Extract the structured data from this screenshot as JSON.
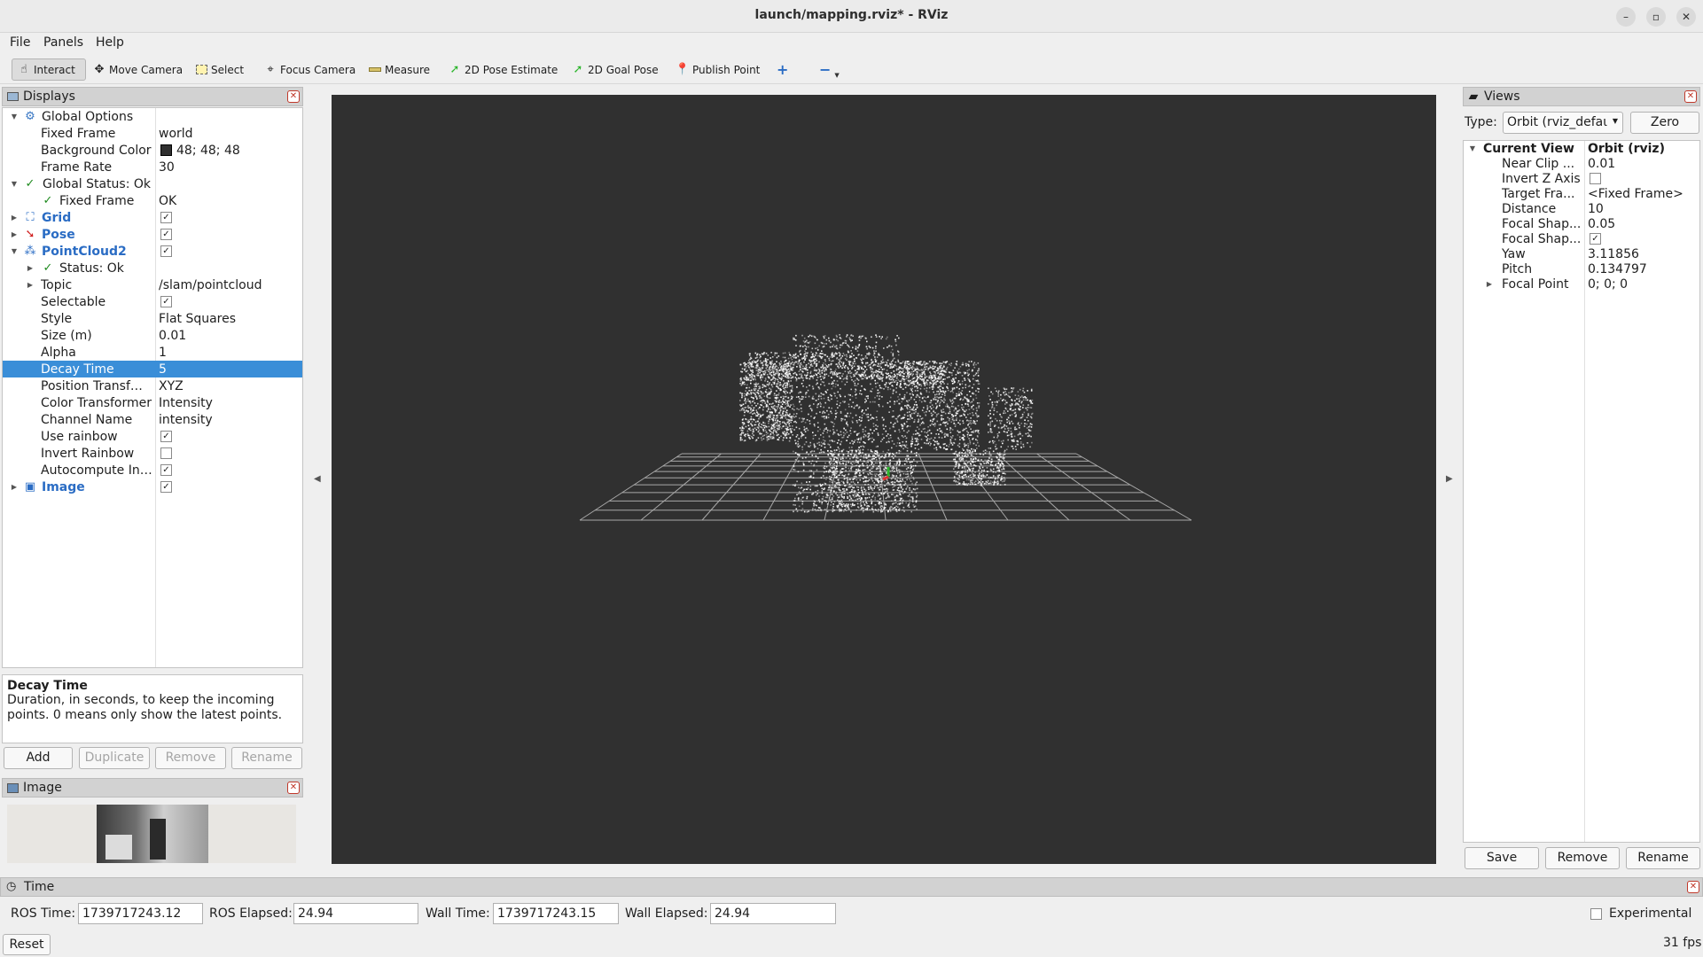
{
  "window": {
    "title": "launch/mapping.rviz* - RViz",
    "minimize": "–",
    "maximize": "▫",
    "close": "✕"
  },
  "menu": [
    "File",
    "Panels",
    "Help"
  ],
  "toolbar": {
    "interact": "Interact",
    "move_camera": "Move Camera",
    "select": "Select",
    "focus_camera": "Focus Camera",
    "measure": "Measure",
    "pose_estimate": "2D Pose Estimate",
    "goal_pose": "2D Goal Pose",
    "publish_point": "Publish Point"
  },
  "displays": {
    "title": "Displays",
    "rows": [
      {
        "label": "Global Options",
        "value": ""
      },
      {
        "label": "Fixed Frame",
        "value": "world"
      },
      {
        "label": "Background Color",
        "value": "48; 48; 48"
      },
      {
        "label": "Frame Rate",
        "value": "30"
      },
      {
        "label": "Global Status: Ok",
        "value": ""
      },
      {
        "label": "Fixed Frame",
        "value": "OK"
      },
      {
        "label": "Grid",
        "value": ""
      },
      {
        "label": "Pose",
        "value": ""
      },
      {
        "label": "PointCloud2",
        "value": ""
      },
      {
        "label": "Status: Ok",
        "value": ""
      },
      {
        "label": "Topic",
        "value": "/slam/pointcloud"
      },
      {
        "label": "Selectable",
        "value": ""
      },
      {
        "label": "Style",
        "value": "Flat Squares"
      },
      {
        "label": "Size (m)",
        "value": "0.01"
      },
      {
        "label": "Alpha",
        "value": "1"
      },
      {
        "label": "Decay Time",
        "value": "5"
      },
      {
        "label": "Position Transf…",
        "value": "XYZ"
      },
      {
        "label": "Color Transformer",
        "value": "Intensity"
      },
      {
        "label": "Channel Name",
        "value": "intensity"
      },
      {
        "label": "Use rainbow",
        "value": ""
      },
      {
        "label": "Invert Rainbow",
        "value": ""
      },
      {
        "label": "Autocompute In…",
        "value": ""
      },
      {
        "label": "Image",
        "value": ""
      }
    ],
    "background_color_hex": "#303030",
    "checkbox_checked": "✓"
  },
  "description": {
    "title": "Decay Time",
    "text": "Duration, in seconds, to keep the incoming points. 0 means only show the latest points."
  },
  "display_buttons": {
    "add": "Add",
    "duplicate": "Duplicate",
    "remove": "Remove",
    "rename": "Rename"
  },
  "image_panel": {
    "title": "Image"
  },
  "views": {
    "title": "Views",
    "type_label": "Type:",
    "type_value": "Orbit (rviz_defaι",
    "zero": "Zero",
    "rows": [
      {
        "label": "Current View",
        "value": "Orbit (rviz)"
      },
      {
        "label": "Near Clip ...",
        "value": "0.01"
      },
      {
        "label": "Invert Z Axis",
        "value": ""
      },
      {
        "label": "Target Fra...",
        "value": "<Fixed Frame>"
      },
      {
        "label": "Distance",
        "value": "10"
      },
      {
        "label": "Focal Shap...",
        "value": "0.05"
      },
      {
        "label": "Focal Shap...",
        "value": ""
      },
      {
        "label": "Yaw",
        "value": "3.11856"
      },
      {
        "label": "Pitch",
        "value": "0.134797"
      },
      {
        "label": "Focal Point",
        "value": "0; 0; 0"
      }
    ],
    "save": "Save",
    "remove": "Remove",
    "rename": "Rename"
  },
  "time": {
    "title": "Time",
    "ros_time_label": "ROS Time:",
    "ros_time": "1739717243.12",
    "ros_elapsed_label": "ROS Elapsed:",
    "ros_elapsed": "24.94",
    "wall_time_label": "Wall Time:",
    "wall_time": "1739717243.15",
    "wall_elapsed_label": "Wall Elapsed:",
    "wall_elapsed": "24.94",
    "experimental": "Experimental",
    "reset": "Reset",
    "fps": "31 fps"
  },
  "colors": {
    "accent": "#3a8ed8",
    "link": "#2a6cc4",
    "viewport_bg": "#303030"
  }
}
